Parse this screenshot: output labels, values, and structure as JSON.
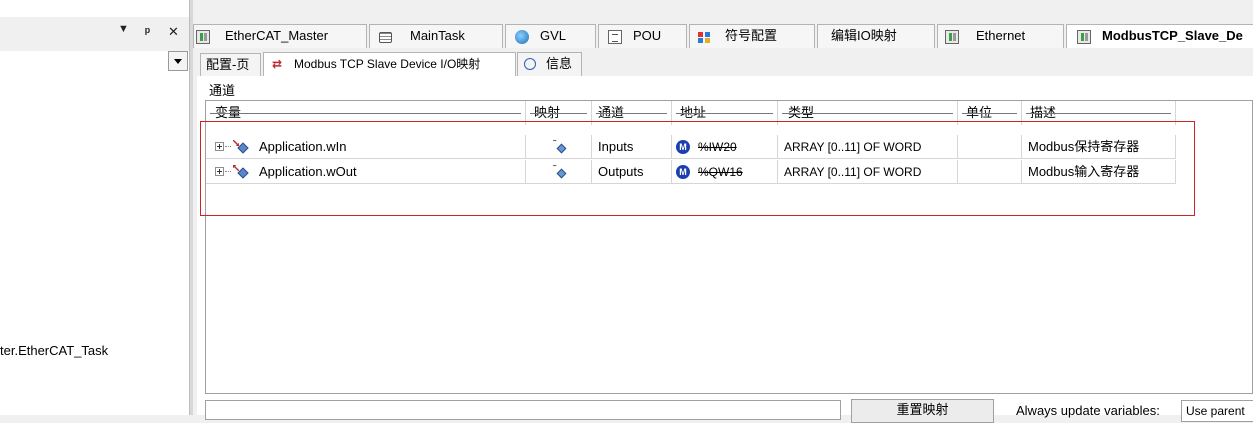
{
  "left_panel": {
    "toolbar": {
      "dropdown_glyph": "▼",
      "pin_glyph": "ᵖ",
      "close_glyph": "✕"
    },
    "tree_node_text": "ter.EtherCAT_Task"
  },
  "editor_tabs": [
    {
      "label": "EtherCAT_Master",
      "icon": "device-icon"
    },
    {
      "label": "MainTask",
      "icon": "task-icon"
    },
    {
      "label": "GVL",
      "icon": "globe-icon"
    },
    {
      "label": "POU",
      "icon": "pou-icon"
    },
    {
      "label": "符号配置",
      "icon": "symbol-icon"
    },
    {
      "label": "编辑IO映射",
      "icon": ""
    },
    {
      "label": "Ethernet",
      "icon": "device-icon"
    },
    {
      "label": "ModbusTCP_Slave_De",
      "icon": "device-icon",
      "active": true
    }
  ],
  "sub_tabs": [
    {
      "label": "配置-页"
    },
    {
      "label": "Modbus TCP Slave Device I/O映射",
      "active": true
    },
    {
      "label": "信息"
    }
  ],
  "channel_title": "通道",
  "table": {
    "headers": [
      "变量",
      "映射",
      "通道",
      "地址",
      "类型",
      "单位",
      "描述"
    ],
    "rows": [
      {
        "variable": "Application.wIn",
        "channel": "Inputs",
        "address": "%IW20",
        "type": "ARRAY [0..11] OF WORD",
        "unit": "",
        "description": "Modbus保持寄存器"
      },
      {
        "variable": "Application.wOut",
        "channel": "Outputs",
        "address": "%QW16",
        "type": "ARRAY [0..11] OF WORD",
        "unit": "",
        "description": "Modbus输入寄存器"
      }
    ]
  },
  "bottom": {
    "reset_button": "重置映射",
    "always_update_label": "Always update variables:",
    "always_update_value": "Use parent"
  },
  "colors": {
    "highlight": "#d42020",
    "m_badge": "#1c3fb0"
  }
}
